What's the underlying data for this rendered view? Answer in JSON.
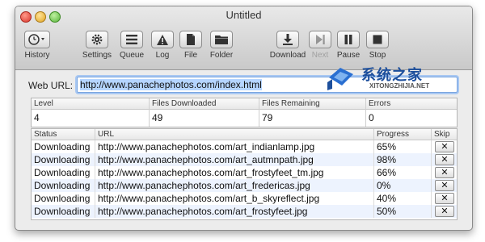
{
  "window": {
    "title": "Untitled"
  },
  "toolbar": {
    "items": [
      {
        "label": "History",
        "icon": "history-clock-icon",
        "enabled": true
      },
      {
        "label": "Settings",
        "icon": "gear-icon",
        "enabled": true
      },
      {
        "label": "Queue",
        "icon": "list-icon",
        "enabled": true
      },
      {
        "label": "Log",
        "icon": "warning-icon",
        "enabled": true
      },
      {
        "label": "File",
        "icon": "document-icon",
        "enabled": true
      },
      {
        "label": "Folder",
        "icon": "folder-icon",
        "enabled": true
      },
      {
        "label": "Download",
        "icon": "download-icon",
        "enabled": true
      },
      {
        "label": "Next",
        "icon": "next-icon",
        "enabled": false
      },
      {
        "label": "Pause",
        "icon": "pause-icon",
        "enabled": true
      },
      {
        "label": "Stop",
        "icon": "stop-icon",
        "enabled": true
      }
    ]
  },
  "url": {
    "label": "Web URL:",
    "value": "http://www.panachephotos.com/index.html"
  },
  "stats": {
    "headers": [
      "Level",
      "Files Downloaded",
      "Files Remaining",
      "Errors"
    ],
    "values": [
      "4",
      "49",
      "79",
      "0"
    ]
  },
  "table": {
    "headers": [
      "Status",
      "URL",
      "Progress",
      "Skip"
    ],
    "rows": [
      {
        "status": "Downloading",
        "url": "http://www.panachephotos.com/art_indianlamp.jpg",
        "progress": "65%",
        "skip": "✕"
      },
      {
        "status": "Downloading",
        "url": "http://www.panachephotos.com/art_autmnpath.jpg",
        "progress": "98%",
        "skip": "✕"
      },
      {
        "status": "Downloading",
        "url": "http://www.panachephotos.com/art_frostyfeet_tm.jpg",
        "progress": "66%",
        "skip": "✕"
      },
      {
        "status": "Downloading",
        "url": "http://www.panachephotos.com/art_fredericas.jpg",
        "progress": "0%",
        "skip": "✕"
      },
      {
        "status": "Downloading",
        "url": "http://www.panachephotos.com/art_b_skyreflect.jpg",
        "progress": "40%",
        "skip": "✕"
      },
      {
        "status": "Downloading",
        "url": "http://www.panachephotos.com/art_frostyfeet.jpg",
        "progress": "50%",
        "skip": "✕"
      }
    ]
  },
  "watermark": {
    "title": "系统之家",
    "subtitle": "XITONGZHIJIA.NET"
  },
  "colors": {
    "selection": "#b5d5ff",
    "focus_ring": "#a9c8f2",
    "row_alt": "#edf3fe",
    "watermark": "#1d4f9c"
  }
}
